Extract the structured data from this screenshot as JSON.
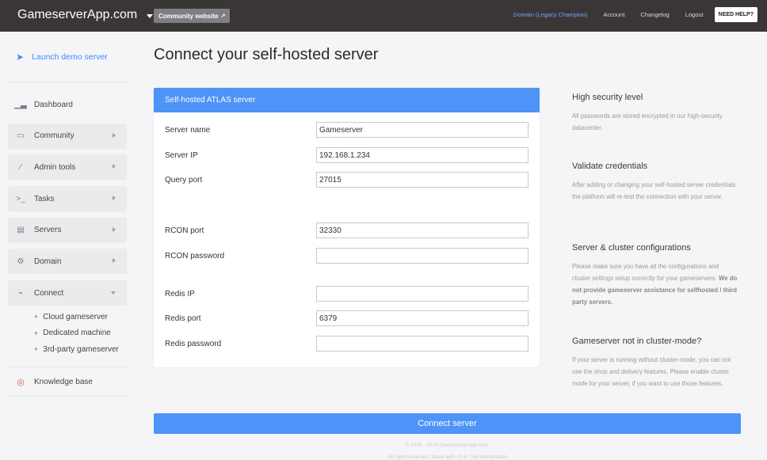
{
  "topbar": {
    "brand": "GameserverApp.com",
    "community_btn": "Community website",
    "nav": {
      "domain": "Domain (Legacy Champion)",
      "account": "Account",
      "changelog": "Changelog",
      "logout": "Logout",
      "help": "NEED HELP?"
    }
  },
  "sidebar": {
    "launch": "Launch demo server",
    "items": {
      "dashboard": "Dashboard",
      "community": "Community",
      "admin_tools": "Admin tools",
      "tasks": "Tasks",
      "servers": "Servers",
      "domain": "Domain",
      "connect": "Connect"
    },
    "subitems": [
      "Cloud gameserver",
      "Dedicated machine",
      "3rd-party gameserver"
    ],
    "knowledge": "Knowledge base"
  },
  "main": {
    "title": "Connect your self-hosted server",
    "card_title": "Self-hosted ATLAS server",
    "fields": {
      "server_name": {
        "label": "Server name",
        "value": "Gameserver"
      },
      "server_ip": {
        "label": "Server IP",
        "value": "192.168.1.234"
      },
      "query_port": {
        "label": "Query port",
        "value": "27015"
      },
      "rcon_port": {
        "label": "RCON port",
        "value": "32330"
      },
      "rcon_password": {
        "label": "RCON password",
        "value": ""
      },
      "redis_ip": {
        "label": "Redis IP",
        "value": ""
      },
      "redis_port": {
        "label": "Redis port",
        "value": "6379"
      },
      "redis_password": {
        "label": "Redis password",
        "value": ""
      }
    },
    "submit": "Connect server",
    "footer_line1": "© 2016 - 2019 GameserverApp.com.",
    "footer_line2": "All rights reserved. Made with <3 in The Netherlands"
  },
  "info": {
    "security": {
      "title": "High security level",
      "text": "All passwords are stored encrypted in our high-security datacenter."
    },
    "validate": {
      "title": "Validate credentials",
      "text": "After adding or changing your self-hosted server credentials the platform will re-test the connection with your server."
    },
    "config": {
      "title": "Server & cluster configurations",
      "text": "Please make sure you have all the configurations and cluster settings setup correctly for your gameservers.",
      "bold": "We do not provide gameserver assistance for selfhosted / third party servers."
    },
    "cluster": {
      "title": "Gameserver not in cluster-mode?",
      "text": "If your server is running without cluster-mode, you can not use the shop and delivery features. Please enable cluster mode for your server, if you want to use those features."
    }
  }
}
